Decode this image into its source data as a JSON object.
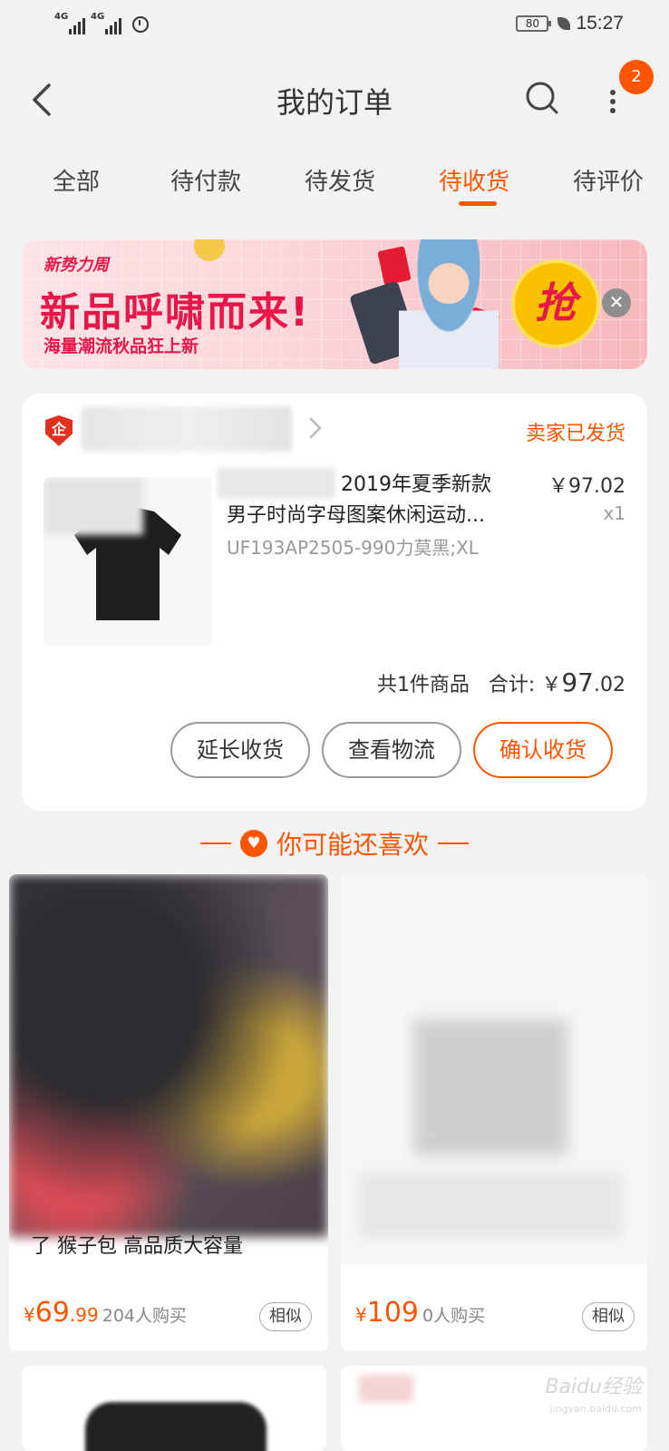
{
  "status_bar": {
    "signal1": "4G",
    "signal2": "4G",
    "battery": "80",
    "time": "15:27"
  },
  "header": {
    "title": "我的订单",
    "notification_count": "2"
  },
  "tabs": [
    {
      "label": "全部"
    },
    {
      "label": "待付款"
    },
    {
      "label": "待发货"
    },
    {
      "label": "待收货",
      "active": true
    },
    {
      "label": "待评价"
    }
  ],
  "banner": {
    "tag": "新势力周",
    "title": "新品呼啸而来!",
    "subtitle": "海量潮流秋品狂上新",
    "cta": "抢"
  },
  "order": {
    "status": "卖家已发货",
    "product_title_line1": "2019年夏季新款",
    "product_title_line2": "男子时尚字母图案休闲运动...",
    "sku": "UF193AP2505-990力莫黑;XL",
    "price": "￥97.02",
    "quantity": "x1",
    "item_count_text": "共1件商品",
    "total_label": "合计:",
    "total_currency": "￥",
    "total_int": "97",
    "total_dec": ".02",
    "buttons": {
      "extend": "延长收货",
      "logistics": "查看物流",
      "confirm": "确认收货"
    }
  },
  "recommend": {
    "heading": "你可能还喜欢",
    "items": [
      {
        "title": "了 猴子包 高品质大容量",
        "currency": "¥",
        "price_int": "69",
        "price_dec": ".99",
        "buyers": "204人购买",
        "similar": "相似"
      },
      {
        "title": "",
        "currency": "¥",
        "price_int": "109",
        "price_dec": "",
        "buyers": "0人购买",
        "similar": "相似"
      }
    ]
  },
  "colors": {
    "accent": "#ff5500",
    "background": "#f2f2f2"
  },
  "watermark": {
    "text": "Baidu经验",
    "sub": "jingyan.baidu.com"
  }
}
